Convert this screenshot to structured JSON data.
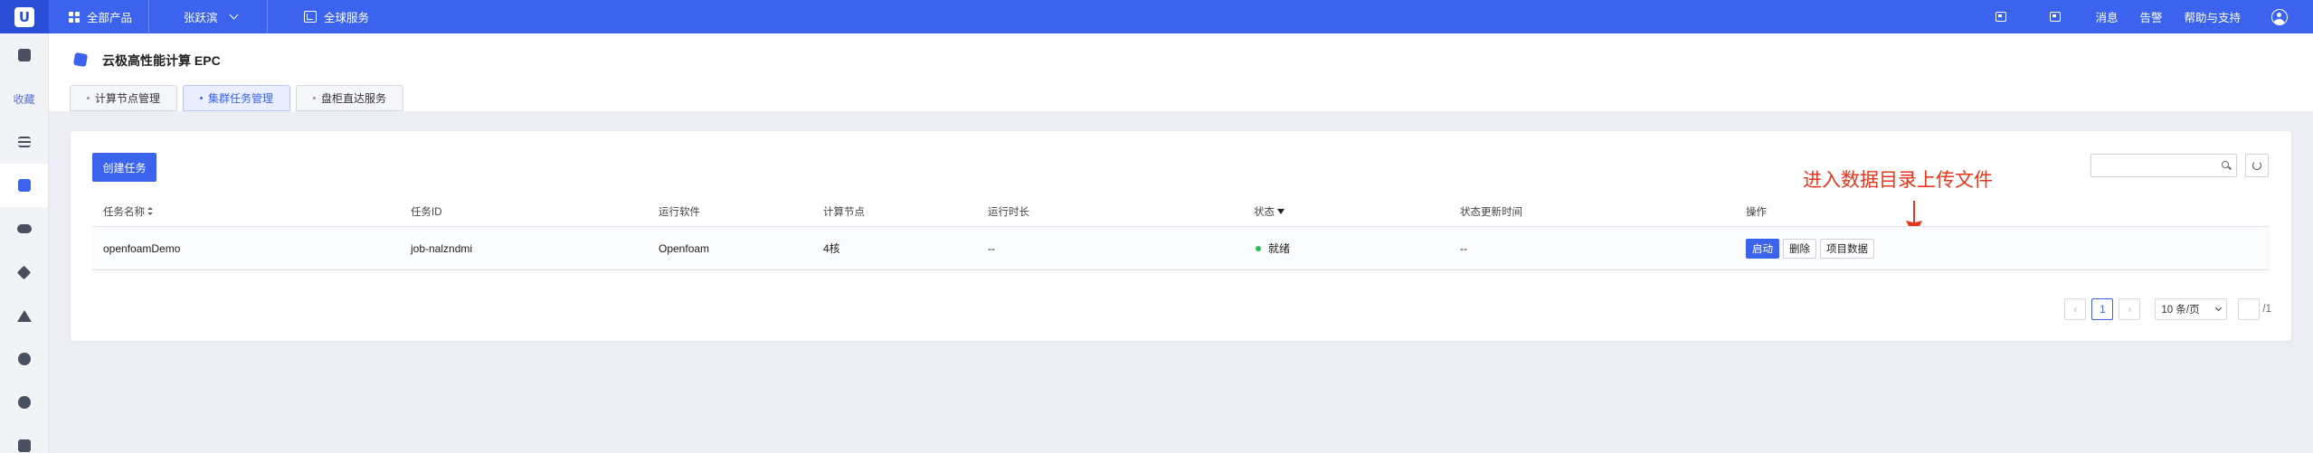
{
  "topbar": {
    "logo": "U",
    "all_products": "全部产品",
    "user": "张跃滨",
    "global_services": "全球服务",
    "messages": "消息",
    "alerts": "告警",
    "help": "帮助与支持"
  },
  "sidebar": {
    "favorites_label": "收藏"
  },
  "product": {
    "title": "云极高性能计算 EPC"
  },
  "tabs": [
    {
      "label": "计算节点管理",
      "active": false
    },
    {
      "label": "集群任务管理",
      "active": true
    },
    {
      "label": "盘柜直达服务",
      "active": false
    }
  ],
  "toolbar": {
    "create_label": "创建任务",
    "search_placeholder": ""
  },
  "annotation": {
    "text": "进入数据目录上传文件",
    "color": "#e8361e"
  },
  "table": {
    "columns": [
      "任务名称",
      "任务ID",
      "运行软件",
      "计算节点",
      "运行时长",
      "状态",
      "状态更新时间",
      "操作"
    ],
    "rows": [
      {
        "name": "openfoamDemo",
        "id": "job-nalzndmi",
        "software": "Openfoam",
        "nodes": "4核",
        "duration": "--",
        "status": "就绪",
        "updated": "--",
        "actions": [
          "启动",
          "删除",
          "项目数据"
        ]
      }
    ]
  },
  "pagination": {
    "prev": "‹",
    "current": "1",
    "next": "›",
    "page_size": "10 条/页",
    "total": "/1"
  },
  "colors": {
    "brand": "#3b63ee",
    "status_ready": "#2bbd5a"
  }
}
